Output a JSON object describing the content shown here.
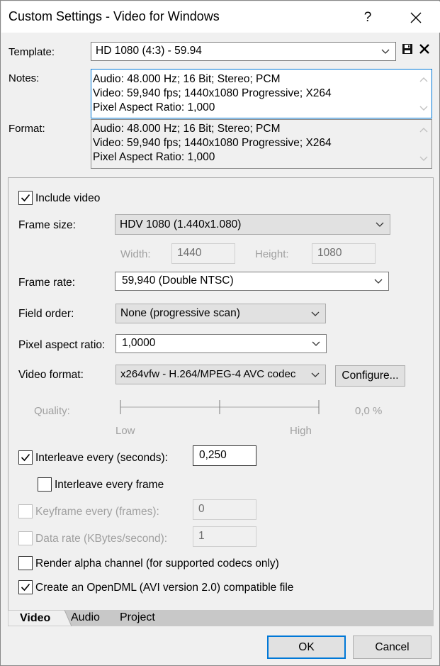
{
  "window": {
    "title": "Custom Settings - Video for Windows",
    "help_glyph": "?"
  },
  "template": {
    "label": "Template:",
    "value": "HD 1080 (4:3) - 59.94"
  },
  "notes": {
    "label": "Notes:",
    "lines": [
      "Audio: 48.000 Hz; 16 Bit; Stereo; PCM",
      "Video: 59,940 fps; 1440x1080 Progressive; X264",
      "Pixel Aspect Ratio: 1,000"
    ]
  },
  "format": {
    "label": "Format:",
    "lines": [
      "Audio: 48.000 Hz; 16 Bit; Stereo; PCM",
      "Video: 59,940 fps; 1440x1080 Progressive; X264",
      "Pixel Aspect Ratio: 1,000"
    ]
  },
  "video": {
    "include_video": {
      "label": "Include video",
      "checked": true
    },
    "frame_size": {
      "label": "Frame size:",
      "value": "HDV 1080 (1.440x1.080)"
    },
    "width": {
      "label": "Width:",
      "value": "1440"
    },
    "height": {
      "label": "Height:",
      "value": "1080"
    },
    "frame_rate": {
      "label": "Frame rate:",
      "value": "59,940 (Double NTSC)"
    },
    "field_order": {
      "label": "Field order:",
      "value": "None (progressive scan)"
    },
    "pixel_aspect": {
      "label": "Pixel aspect ratio:",
      "value": "1,0000"
    },
    "video_format": {
      "label": "Video format:",
      "value": "x264vfw - H.264/MPEG-4 AVC codec",
      "configure_label": "Configure..."
    },
    "quality": {
      "label": "Quality:",
      "low": "Low",
      "high": "High",
      "value_text": "0,0 %",
      "level": 0.0
    },
    "interleave": {
      "label": "Interleave every (seconds):",
      "checked": true,
      "value": "0,250"
    },
    "interleave_frame": {
      "label": "Interleave every frame",
      "checked": false
    },
    "keyframe": {
      "label": "Keyframe every (frames):",
      "checked": false,
      "value": "0"
    },
    "data_rate": {
      "label": "Data rate (KBytes/second):",
      "checked": false,
      "value": "1"
    },
    "render_alpha": {
      "label": "Render alpha channel (for supported codecs only)",
      "checked": false
    },
    "opendml": {
      "label": "Create an OpenDML (AVI version 2.0) compatible file",
      "checked": true
    }
  },
  "tabs": [
    {
      "label": "Video",
      "active": true
    },
    {
      "label": "Audio",
      "active": false
    },
    {
      "label": "Project",
      "active": false
    }
  ],
  "buttons": {
    "ok": "OK",
    "cancel": "Cancel"
  },
  "colors": {
    "accent": "#0078d7",
    "check": "#000000",
    "disabled_text": "#a0a0a0"
  },
  "icons": {
    "save": "save-disk-icon",
    "delete": "delete-x-icon"
  }
}
